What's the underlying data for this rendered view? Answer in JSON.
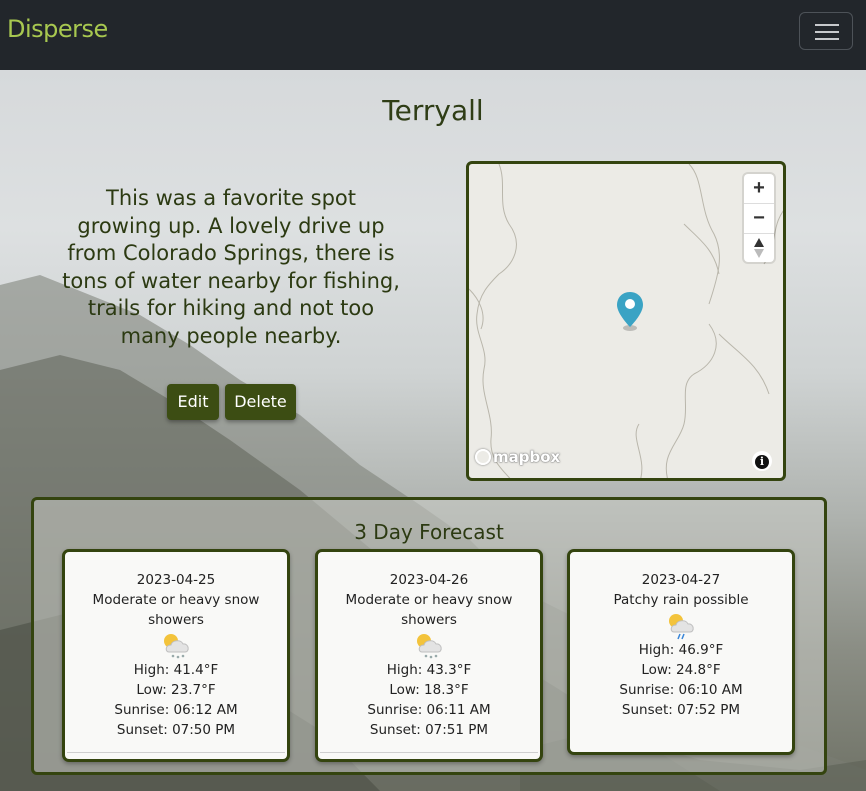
{
  "navbar": {
    "brand": "Disperse",
    "menu_toggle_icon": "hamburger-icon"
  },
  "spot": {
    "title": "Terryall",
    "description": "This was a favorite spot growing up. A lovely drive up from Colorado Springs, there is tons of water nearby for fishing, trails for hiking and not too many people nearby.",
    "edit_label": "Edit",
    "delete_label": "Delete"
  },
  "map": {
    "zoom_in_label": "+",
    "zoom_out_label": "−",
    "compass_icon": "compass-icon",
    "marker_icon": "map-pin-icon",
    "attribution_logo": "mapbox",
    "info_label": "i"
  },
  "forecast": {
    "title": "3 Day Forecast",
    "days": [
      {
        "date": "2023-04-25",
        "condition": "Moderate or heavy snow showers",
        "icon": "snow-shower-icon",
        "high": "High: 41.4°F",
        "low": "Low: 23.7°F",
        "sunrise": "Sunrise: 06:12 AM",
        "sunset": "Sunset: 07:50 PM"
      },
      {
        "date": "2023-04-26",
        "condition": "Moderate or heavy snow showers",
        "icon": "snow-shower-icon",
        "high": "High: 43.3°F",
        "low": "Low: 18.3°F",
        "sunrise": "Sunrise: 06:11 AM",
        "sunset": "Sunset: 07:51 PM"
      },
      {
        "date": "2023-04-27",
        "condition": "Patchy rain possible",
        "icon": "rain-shower-icon",
        "high": "High: 46.9°F",
        "low": "Low: 24.8°F",
        "sunrise": "Sunrise: 06:10 AM",
        "sunset": "Sunset: 07:52 PM"
      }
    ]
  },
  "colors": {
    "brand": "#a8c850",
    "accent": "#3c4d13",
    "border": "#34440f",
    "navbar_bg": "#22262b",
    "marker": "#3aa3c4"
  }
}
